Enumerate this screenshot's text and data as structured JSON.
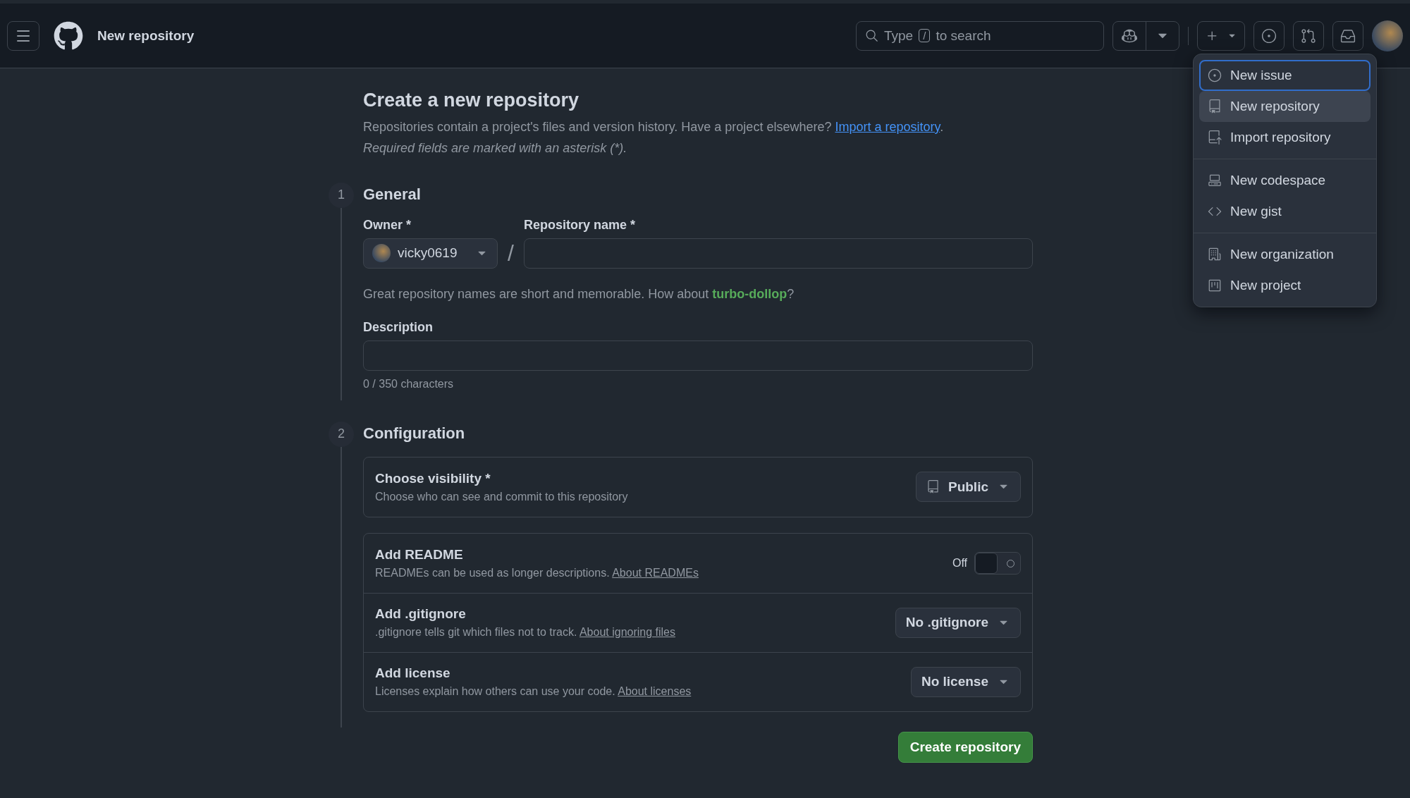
{
  "header": {
    "title": "New repository",
    "search": {
      "prefix": "Type",
      "key": "/",
      "suffix": "to search"
    }
  },
  "menu": {
    "groups": [
      [
        {
          "label": "New issue",
          "focused": true,
          "hovered": false
        },
        {
          "label": "New repository",
          "focused": false,
          "hovered": true
        },
        {
          "label": "Import repository",
          "focused": false,
          "hovered": false
        }
      ],
      [
        {
          "label": "New codespace",
          "focused": false,
          "hovered": false
        },
        {
          "label": "New gist",
          "focused": false,
          "hovered": false
        }
      ],
      [
        {
          "label": "New organization",
          "focused": false,
          "hovered": false
        },
        {
          "label": "New project",
          "focused": false,
          "hovered": false
        }
      ]
    ]
  },
  "form": {
    "heading": "Create a new repository",
    "intro": {
      "text": "Repositories contain a project's files and version history. Have a project elsewhere?",
      "link": "Import a repository",
      "end": "."
    },
    "required_note": "Required fields are marked with an asterisk (*).",
    "steps": [
      {
        "number": "1",
        "title": "General",
        "kind": "general",
        "owner_label": "Owner *",
        "owner": "vicky0619",
        "separator": "/",
        "name_label": "Repository name *",
        "hint": {
          "text": "Great repository names are short and memorable. How about",
          "suggestion": "turbo-dollop",
          "end": "?"
        },
        "description_label": "Description",
        "counter": "0 / 350 characters"
      },
      {
        "number": "2",
        "title": "Configuration",
        "kind": "configuration",
        "visibility": {
          "title": "Choose visibility *",
          "subtitle": "Choose who can see and commit to this repository",
          "value": "Public"
        },
        "options": [
          {
            "kind": "toggle",
            "title": "Add README",
            "text": "READMEs can be used as longer descriptions.",
            "link": "About READMEs",
            "state_label": "Off",
            "on": false
          },
          {
            "kind": "select",
            "title": "Add .gitignore",
            "text": ".gitignore tells git which files not to track.",
            "link": "About ignoring files",
            "value": "No .gitignore"
          },
          {
            "kind": "select",
            "title": "Add license",
            "text": "Licenses explain how others can use your code.",
            "link": "About licenses",
            "value": "No license"
          }
        ]
      }
    ],
    "submit": "Create repository"
  }
}
